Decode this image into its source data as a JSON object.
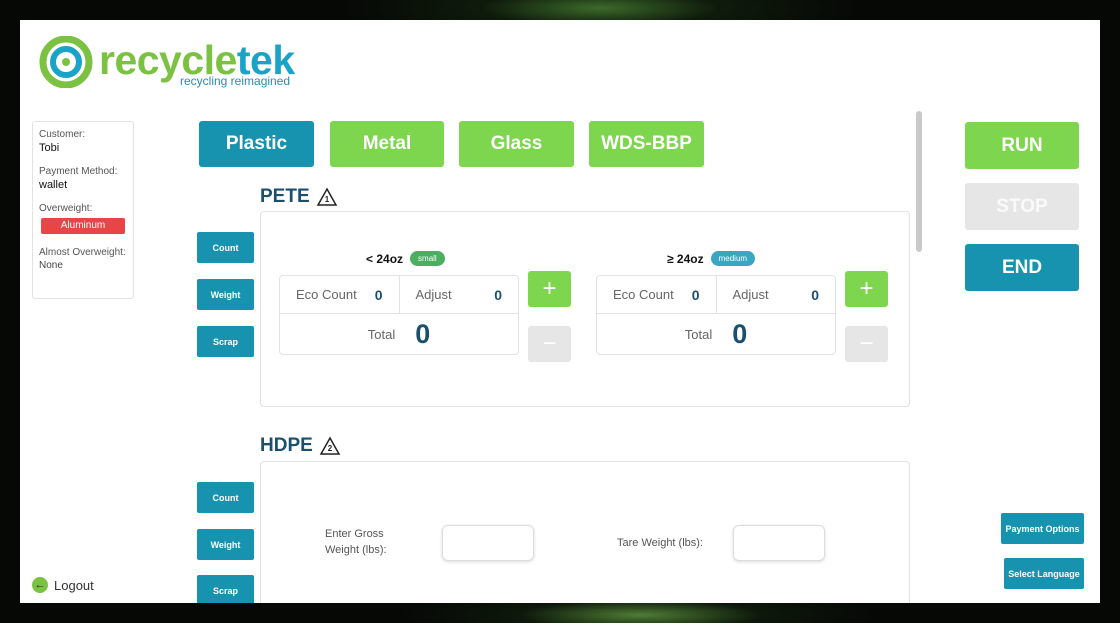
{
  "brand": {
    "name_part1": "recycle",
    "name_part2": "tek",
    "tagline": "recycling reimagined"
  },
  "customer": {
    "customer_label": "Customer:",
    "customer_value": "Tobi",
    "payment_label": "Payment Method:",
    "payment_value": "wallet",
    "overweight_label": "Overweight:",
    "overweight_badge": "Aluminum",
    "almost_label": "Almost Overweight:",
    "almost_value": "None"
  },
  "logout": {
    "label": "Logout"
  },
  "categories": [
    {
      "label": "Plastic",
      "active": true
    },
    {
      "label": "Metal",
      "active": false
    },
    {
      "label": "Glass",
      "active": false
    },
    {
      "label": "WDS-BBP",
      "active": false
    }
  ],
  "actions": {
    "run": "RUN",
    "stop": "STOP",
    "end": "END",
    "payment_options": "Payment Options",
    "select_language": "Select Language"
  },
  "modes": {
    "count": "Count",
    "weight": "Weight",
    "scrap": "Scrap"
  },
  "pete": {
    "title": "PETE",
    "recycle_number": "1",
    "counters": [
      {
        "size": "< 24oz",
        "badge": "small",
        "eco_label": "Eco Count",
        "eco_value": "0",
        "adjust_label": "Adjust",
        "adjust_value": "0",
        "total_label": "Total",
        "total_value": "0"
      },
      {
        "size": "≥ 24oz",
        "badge": "medium",
        "eco_label": "Eco Count",
        "eco_value": "0",
        "adjust_label": "Adjust",
        "adjust_value": "0",
        "total_label": "Total",
        "total_value": "0"
      }
    ],
    "plus": "+",
    "minus": "−"
  },
  "hdpe": {
    "title": "HDPE",
    "recycle_number": "2",
    "gross_label": "Enter Gross Weight (lbs):",
    "tare_label": "Tare Weight (lbs):"
  },
  "colors": {
    "teal": "#1793b0",
    "green": "#7dd64e",
    "red": "#e84646",
    "navy": "#1b4f6e"
  }
}
